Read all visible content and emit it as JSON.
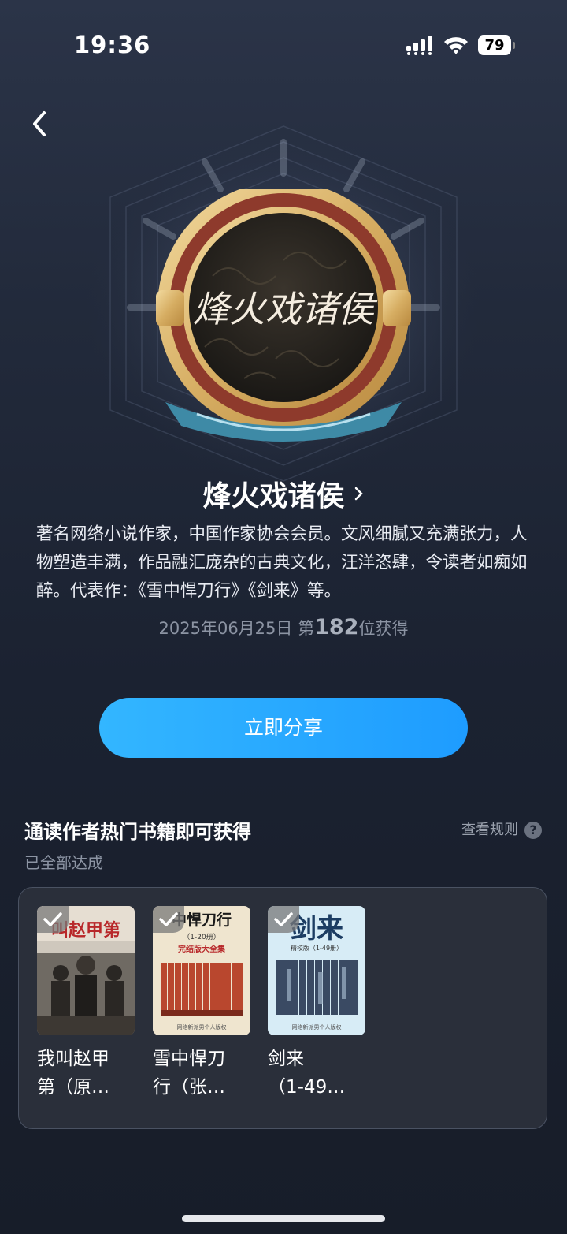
{
  "status_bar": {
    "time": "19:36",
    "battery": "79"
  },
  "badge": {
    "emblem_text": "烽火戏诸侯",
    "title": "烽火戏诸侯",
    "description": "著名网络小说作家，中国作家协会会员。文风细腻又充满张力，人物塑造丰满，作品融汇庞杂的古典文化，汪洋恣肆，令读者如痴如醉。代表作：《雪中悍刀行》《剑来》等。",
    "obtained_date": "2025年06月25日",
    "rank_prefix": "第",
    "rank_number": "182",
    "rank_suffix": "位获得"
  },
  "share_button": {
    "label": "立即分享"
  },
  "task": {
    "title": "通读作者热门书籍即可获得",
    "rules_label": "查看规则",
    "status": "已全部达成",
    "books": [
      {
        "name_line1": "我叫赵甲",
        "name_line2": "第（原…",
        "cover_text": "叫赵甲第",
        "completed": true
      },
      {
        "name_line1": "雪中悍刀",
        "name_line2": "行（张…",
        "cover_text": "中悍刀行",
        "cover_sub": "（1-20册）",
        "cover_sub2": "完结版大全集",
        "cover_footer": "网络新派男个人版权",
        "completed": true
      },
      {
        "name_line1": "剑来",
        "name_line2": "（1-49…",
        "cover_text": "剑来",
        "cover_sub": "精校版（1-49册）",
        "cover_footer": "网络新派男个人版权",
        "completed": true
      }
    ]
  },
  "colors": {
    "accent": "#1e9cff",
    "background": "#1b2231",
    "gold": "#d9b56e"
  }
}
